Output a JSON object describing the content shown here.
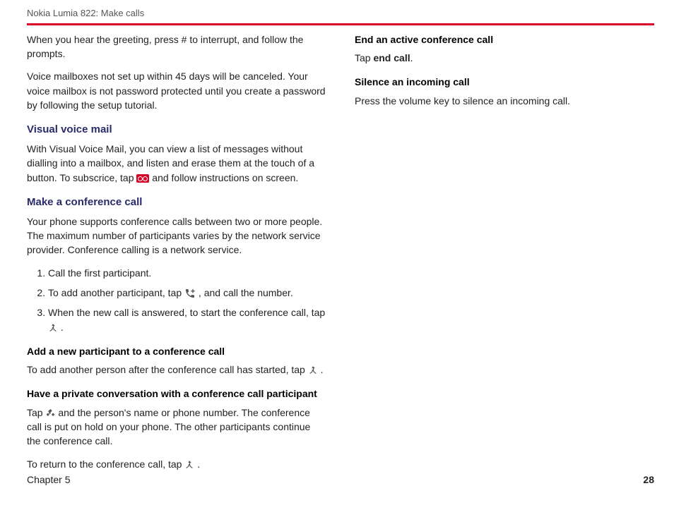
{
  "header": {
    "title": "Nokia Lumia 822: Make calls"
  },
  "col1": {
    "intro1": "When you hear the greeting, press # to interrupt, and follow the prompts.",
    "intro2": "Voice mailboxes not set up within 45 days will be canceled. Your voice mailbox is not password protected until you create a password by following the setup tutorial.",
    "vvm": {
      "heading": "Visual voice mail",
      "text_a": "With Visual Voice Mail, you can view a list of messages without dialling into a mailbox, and listen and erase them at the touch of a button.  To subscrice, tap ",
      "text_b": " and follow instructions on screen."
    },
    "conf": {
      "heading": "Make a conference call",
      "text": "Your phone supports conference calls between two or more people. The maximum number of participants varies by the network service provider. Conference calling is a network service.",
      "steps": {
        "s1": "Call the first participant.",
        "s2a": "To add another participant, tap ",
        "s2b": " , and call the number.",
        "s3a": "When the new call is answered, to start the conference call, tap ",
        "s3b": "."
      }
    },
    "addp": {
      "heading": "Add a new participant to a conference call",
      "text_a": "To add another person after the conference call has started, tap ",
      "text_b": "."
    },
    "priv": {
      "heading": "Have a private conversation with a conference call participant",
      "p1a": "Tap ",
      "p1b": " and the person's name or phone number. The conference call is put on hold on your phone. The other participants continue the conference call.",
      "p2a": "To return to the conference call, tap ",
      "p2b": " ."
    }
  },
  "col2": {
    "end": {
      "heading": "End an active conference call",
      "text_a": "Tap ",
      "text_b": "end call",
      "text_c": "."
    },
    "silence": {
      "heading": "Silence an incoming call",
      "text": "Press the volume key to silence an incoming call."
    }
  },
  "footer": {
    "chapter": "Chapter 5",
    "pagenum": "28"
  }
}
